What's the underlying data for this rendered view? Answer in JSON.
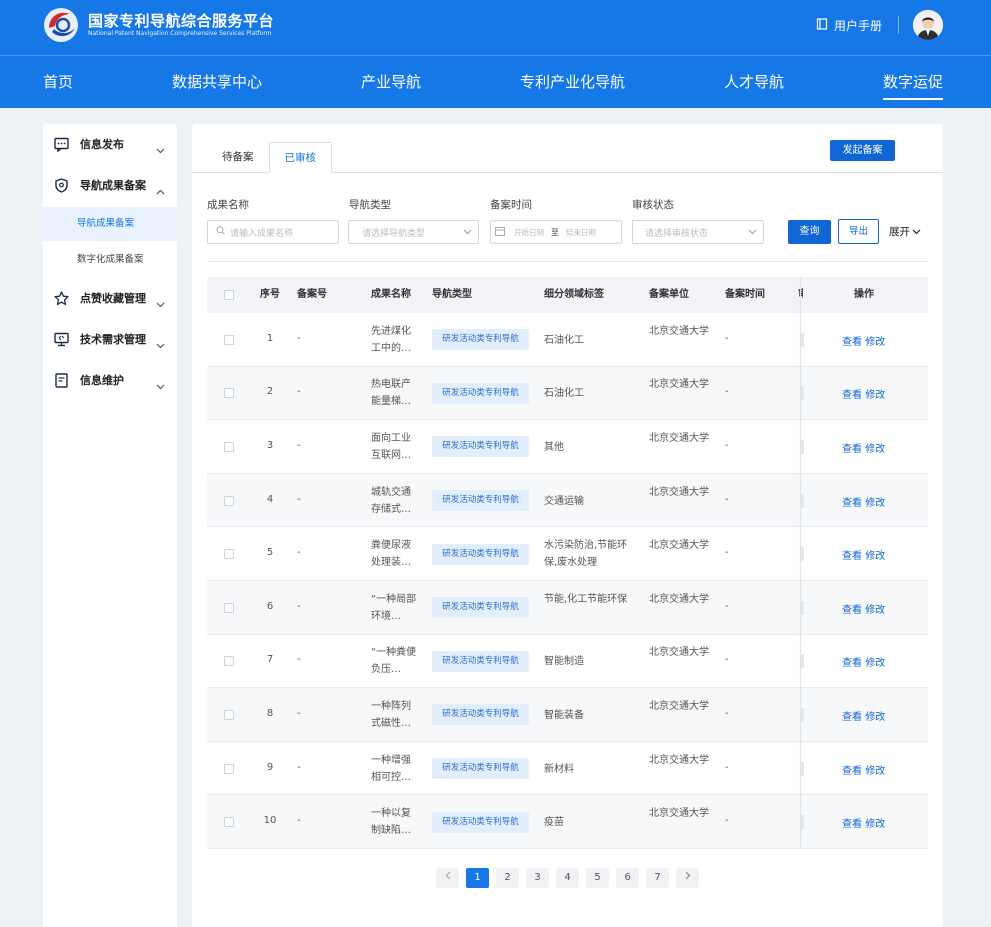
{
  "header": {
    "title_cn": "国家专利导航综合服务平台",
    "title_en": "National Patent Navigation Comprehensive Services Platform",
    "manual_label": "用户手册",
    "colors": {
      "primary": "#1677e6",
      "accent": "#1166d6",
      "tag_bg": "#e3eefc"
    }
  },
  "nav": {
    "items": [
      {
        "label": "首页"
      },
      {
        "label": "数据共享中心"
      },
      {
        "label": "产业导航"
      },
      {
        "label": "专利产业化导航"
      },
      {
        "label": "人才导航"
      },
      {
        "label": "数字运促"
      }
    ],
    "active_index": 5
  },
  "sidebar": {
    "groups": [
      {
        "label": "信息发布",
        "icon": "message-icon",
        "expanded": false
      },
      {
        "label": "导航成果备案",
        "icon": "shield-icon",
        "expanded": true
      },
      {
        "label": "点赞收藏管理",
        "icon": "star-icon",
        "expanded": false
      },
      {
        "label": "技术需求管理",
        "icon": "monitor-icon",
        "expanded": false
      },
      {
        "label": "信息维护",
        "icon": "document-icon",
        "expanded": false
      }
    ],
    "subitems": [
      {
        "label": "导航成果备案",
        "active": true
      },
      {
        "label": "数字化成果备案",
        "active": false
      }
    ]
  },
  "tabs": [
    {
      "label": "待备案",
      "active": false
    },
    {
      "label": "已审核",
      "active": true
    }
  ],
  "actions": {
    "new_label": "发起备案",
    "query_label": "查询",
    "export_label": "导出",
    "expand_label": "展开"
  },
  "filters": {
    "name": {
      "label": "成果名称",
      "placeholder": "请输入成果名称"
    },
    "type": {
      "label": "导航类型",
      "placeholder": "请选择导航类型"
    },
    "time": {
      "label": "备案时间",
      "start_placeholder": "开始日期",
      "separator": "至",
      "end_placeholder": "结束日期"
    },
    "status": {
      "label": "审核状态",
      "placeholder": "请选择审核状态"
    }
  },
  "table": {
    "columns": [
      "序号",
      "备案号",
      "成果名称",
      "导航类型",
      "细分领域标签",
      "备案单位",
      "备案时间",
      "操作"
    ],
    "truncated_column_char": "审",
    "view_label": "查看",
    "edit_label": "修改",
    "rows": [
      {
        "idx": "1",
        "num": "-",
        "name": "先进煤化工中的…",
        "type": "研发活动类专利导航",
        "domain": "石油化工",
        "unit": "北京交通大学",
        "time": "-"
      },
      {
        "idx": "2",
        "num": "-",
        "name": "热电联产能量梯…",
        "type": "研发活动类专利导航",
        "domain": "石油化工",
        "unit": "北京交通大学",
        "time": "-"
      },
      {
        "idx": "3",
        "num": "-",
        "name": "面向工业互联网…",
        "type": "研发活动类专利导航",
        "domain": "其他",
        "unit": "北京交通大学",
        "time": "-"
      },
      {
        "idx": "4",
        "num": "-",
        "name": "城轨交通存储式…",
        "type": "研发活动类专利导航",
        "domain": "交通运输",
        "unit": "北京交通大学",
        "time": "-"
      },
      {
        "idx": "5",
        "num": "-",
        "name": "粪便尿液处理装…",
        "type": "研发活动类专利导航",
        "domain": "水污染防治,节能环保,废水处理",
        "unit": "北京交通大学",
        "time": "-"
      },
      {
        "idx": "6",
        "num": "-",
        "name": "“一种局部环境…",
        "type": "研发活动类专利导航",
        "domain": "节能,化工节能环保",
        "unit": "北京交通大学",
        "time": "-"
      },
      {
        "idx": "7",
        "num": "-",
        "name": "“一种粪便负压…",
        "type": "研发活动类专利导航",
        "domain": "智能制造",
        "unit": "北京交通大学",
        "time": "-"
      },
      {
        "idx": "8",
        "num": "-",
        "name": "一种阵列式磁性…",
        "type": "研发活动类专利导航",
        "domain": "智能装备",
        "unit": "北京交通大学",
        "time": "-"
      },
      {
        "idx": "9",
        "num": "-",
        "name": "一种增强相可控…",
        "type": "研发活动类专利导航",
        "domain": "新材料",
        "unit": "北京交通大学",
        "time": "-"
      },
      {
        "idx": "10",
        "num": "-",
        "name": "一种以复制缺陷…",
        "type": "研发活动类专利导航",
        "domain": "疫苗",
        "unit": "北京交通大学",
        "time": "-"
      }
    ]
  },
  "pagination": {
    "pages": [
      "1",
      "2",
      "3",
      "4",
      "5",
      "6",
      "7"
    ],
    "current": "1",
    "prev_icon": "chevron-left-icon",
    "next_icon": "chevron-right-icon"
  }
}
